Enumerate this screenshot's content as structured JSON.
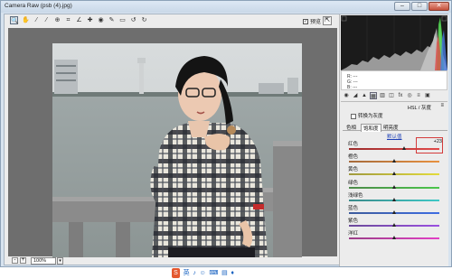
{
  "window": {
    "title": "Camera Raw (psb (4).jpg)"
  },
  "toolbar": {
    "tools": [
      "zoom-icon",
      "hand-icon",
      "white-balance-icon",
      "color-sampler-icon",
      "targeted-adjustment-icon",
      "crop-icon",
      "straighten-icon",
      "spot-removal-icon",
      "red-eye-icon",
      "adjustment-brush-icon",
      "graduated-filter-icon",
      "rotate-left-icon",
      "rotate-right-icon"
    ],
    "preview_label": "预览",
    "preview_checked": true
  },
  "zoom": {
    "minus": "-",
    "plus": "+",
    "value": "100%"
  },
  "histogram": {
    "readout": {
      "r_label": "R:",
      "g_label": "G:",
      "b_label": "B:",
      "r_value": "---",
      "g_value": "---",
      "b_value": "---"
    }
  },
  "panel": {
    "section_title": "HSL / 灰度",
    "convert_grayscale_label": "转换为灰度",
    "subtabs": [
      "色相",
      "饱和度",
      "明亮度"
    ],
    "active_subtab": 1,
    "default_link": "默认值",
    "sliders": [
      {
        "label": "红色",
        "value": "+23",
        "fraction": 0.615,
        "colors": [
          "#9b2b2b",
          "#e24a4a"
        ]
      },
      {
        "label": "橙色",
        "value": "",
        "fraction": 0.5,
        "colors": [
          "#a66a3a",
          "#e8913f"
        ]
      },
      {
        "label": "黄色",
        "value": "",
        "fraction": 0.5,
        "colors": [
          "#a09a3e",
          "#e3db3b"
        ]
      },
      {
        "label": "绿色",
        "value": "",
        "fraction": 0.5,
        "colors": [
          "#4c8a4a",
          "#4cc64b"
        ]
      },
      {
        "label": "浅绿色",
        "value": "",
        "fraction": 0.5,
        "colors": [
          "#3a8a8a",
          "#3ec8c6"
        ]
      },
      {
        "label": "蓝色",
        "value": "",
        "fraction": 0.5,
        "colors": [
          "#3c5b9c",
          "#3f6de2"
        ]
      },
      {
        "label": "紫色",
        "value": "",
        "fraction": 0.5,
        "colors": [
          "#6b4a9a",
          "#9a4fe0"
        ]
      },
      {
        "label": "洋红",
        "value": "",
        "fraction": 0.5,
        "colors": [
          "#9a3e87",
          "#e23fc5"
        ]
      }
    ]
  },
  "buttons": {
    "cancel": "取消",
    "done": "完成"
  },
  "ime": {
    "logo": "S",
    "lang": "英"
  }
}
